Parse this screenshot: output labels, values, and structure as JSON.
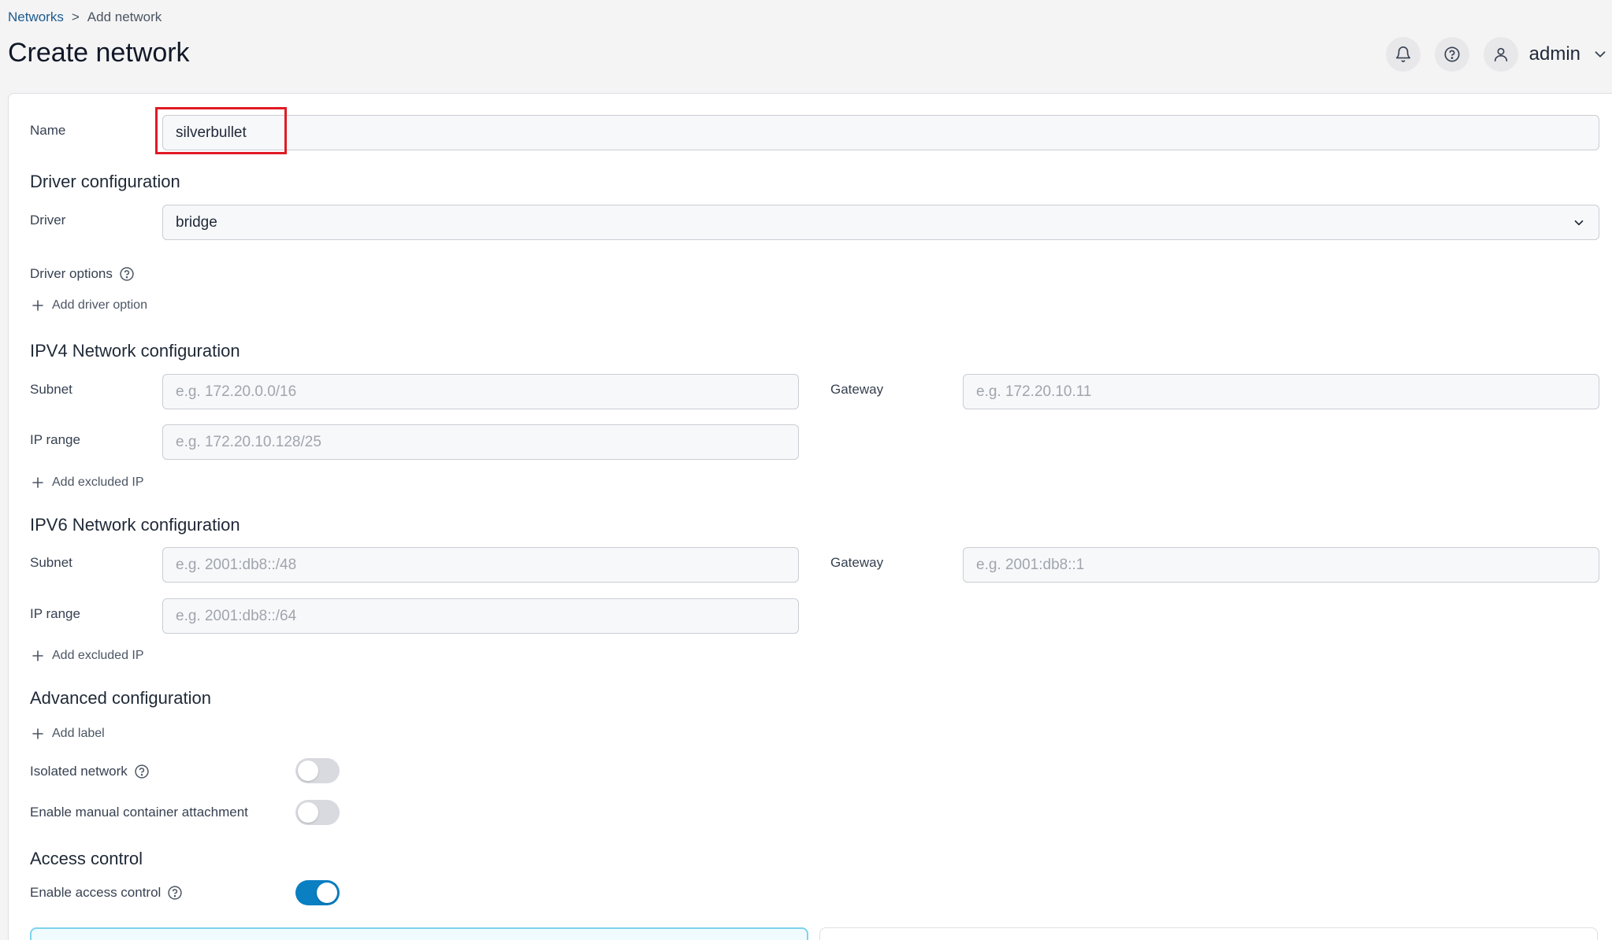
{
  "breadcrumb": {
    "parent": "Networks",
    "separator": ">",
    "current": "Add network"
  },
  "page_title": "Create network",
  "header": {
    "user_name": "admin"
  },
  "name_field": {
    "label": "Name",
    "value": "silverbullet"
  },
  "driver_config": {
    "title": "Driver configuration",
    "driver_label": "Driver",
    "driver_value": "bridge",
    "options_label": "Driver options",
    "add_option": "Add driver option"
  },
  "ipv4": {
    "title": "IPV4 Network configuration",
    "subnet_label": "Subnet",
    "subnet_placeholder": "e.g. 172.20.0.0/16",
    "gateway_label": "Gateway",
    "gateway_placeholder": "e.g. 172.20.10.11",
    "range_label": "IP range",
    "range_placeholder": "e.g. 172.20.10.128/25",
    "add_excluded": "Add excluded IP"
  },
  "ipv6": {
    "title": "IPV6 Network configuration",
    "subnet_label": "Subnet",
    "subnet_placeholder": "e.g. 2001:db8::/48",
    "gateway_label": "Gateway",
    "gateway_placeholder": "e.g. 2001:db8::1",
    "range_label": "IP range",
    "range_placeholder": "e.g. 2001:db8::/64",
    "add_excluded": "Add excluded IP"
  },
  "advanced": {
    "title": "Advanced configuration",
    "add_label": "Add label",
    "isolated_label": "Isolated network",
    "isolated_on": false,
    "manual_label": "Enable manual container attachment",
    "manual_on": false
  },
  "access": {
    "title": "Access control",
    "enable_label": "Enable access control",
    "enable_on": true
  },
  "colors": {
    "accent": "#0a7fc2",
    "link": "#1d5b8f",
    "highlight": "#e01b24"
  }
}
